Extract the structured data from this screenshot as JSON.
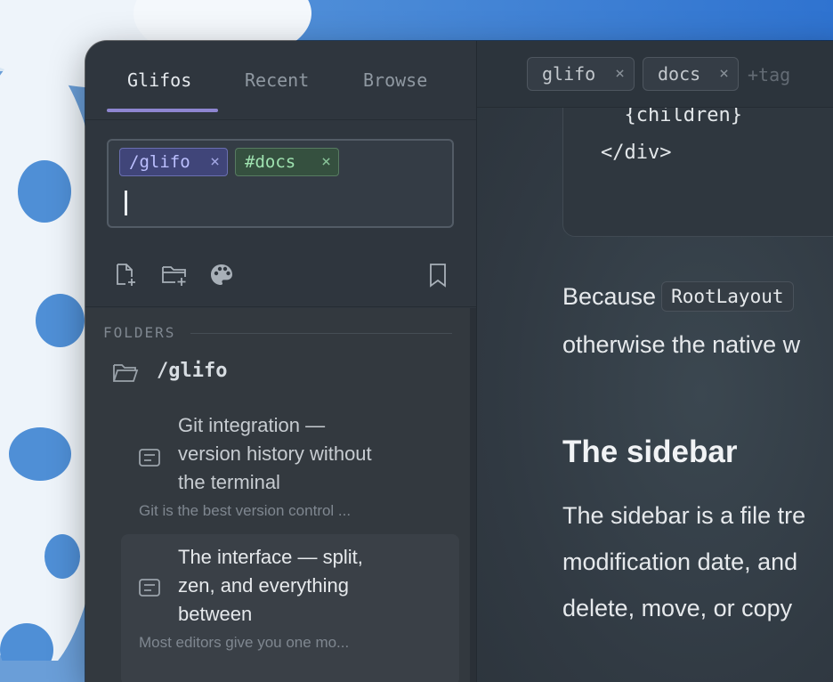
{
  "colors": {
    "accent": "#8e86d1",
    "tag_folder_bg": "#404579",
    "tag_hashtag_bg": "#35503f",
    "sidebar_bg": "#2f363e",
    "editor_bg": "#313a43"
  },
  "sidebar": {
    "tabs": [
      {
        "label": "Glifos",
        "active": true
      },
      {
        "label": "Recent",
        "active": false
      },
      {
        "label": "Browse",
        "active": false
      }
    ],
    "tag_input": {
      "chips": [
        {
          "label": "/glifo",
          "kind": "folder"
        },
        {
          "label": "#docs",
          "kind": "hashtag"
        }
      ],
      "remove_glyph": "×"
    },
    "toolbar": {
      "icons": [
        "new-note-icon",
        "new-folder-icon",
        "palette-icon",
        "bookmark-icon"
      ]
    },
    "tree": {
      "section_label": "FOLDERS",
      "folder": {
        "name": "/glifo",
        "icon": "folder-open-icon"
      },
      "notes": [
        {
          "title_lines": [
            "Git integration —",
            "version history without",
            "the terminal"
          ],
          "excerpt": "Git is the best version control ...",
          "selected": false
        },
        {
          "title_lines": [
            "The interface — split,",
            "zen, and everything",
            "between"
          ],
          "excerpt": "Most editors give you one mo...",
          "selected": true
        }
      ]
    }
  },
  "editor": {
    "tag_chips": [
      "glifo",
      "docs"
    ],
    "add_tag": "+tag",
    "code_lines": [
      "}}>",
      "  {children}",
      "</div>"
    ],
    "paragraph1": {
      "before": "Because",
      "code": "RootLayout",
      "line2": "otherwise the native w"
    },
    "heading": "The sidebar",
    "paragraph2": [
      "The sidebar is a file tre",
      "modification date, and",
      "delete, move, or copy"
    ]
  }
}
